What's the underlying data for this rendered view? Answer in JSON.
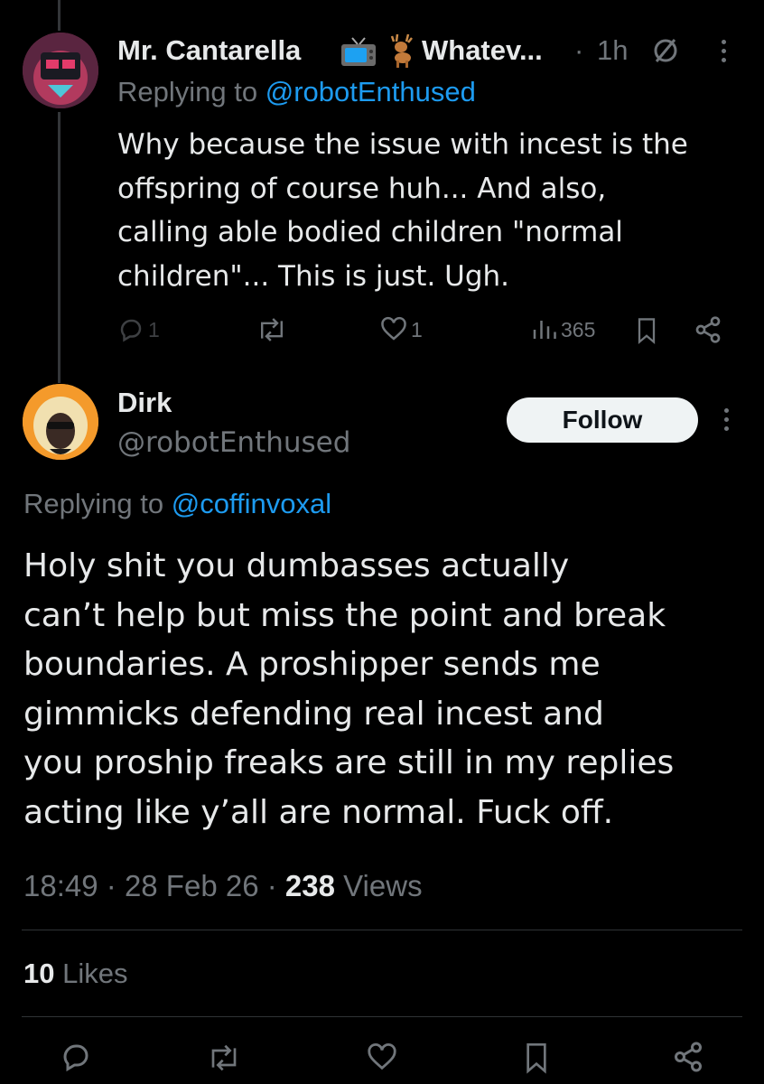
{
  "reply_tweet": {
    "display_name": "Mr. Cantarella",
    "name_suffix": "Whatev...",
    "time_sep": "·",
    "time": "1h",
    "replying_prefix": "Replying to",
    "replying_handle": "@robotEnthused",
    "text_lines": [
      "Why because the issue with incest is the",
      "offspring of course huh... And also,",
      "calling able bodied children \"normal",
      "children\"... This is just. Ugh."
    ],
    "reply_count": "1",
    "like_count": "1",
    "view_count": "365",
    "icons": [
      "tv-emoji-icon",
      "deer-emoji-icon",
      "muted-circle-icon",
      "more-icon"
    ]
  },
  "main_tweet": {
    "display_name": "Dirk",
    "handle": "@robotEnthused",
    "follow_label": "Follow",
    "replying_prefix": "Replying to",
    "replying_handle": "@coffinvoxal",
    "text_lines": [
      "Holy shit you dumbasses actually",
      "can’t help but miss the point and break",
      "boundaries. A proshipper sends me",
      "gimmicks defending real incest and",
      "you proship freaks are still in my replies",
      "acting like y’all are normal. Fuck off."
    ],
    "time": "18:49",
    "sep": "·",
    "date": "28 Feb 26",
    "views_count": "238",
    "views_label": "Views",
    "likes_count": "10",
    "likes_label": "Likes"
  },
  "colors": {
    "background": "#000000",
    "text": "#e7e9ea",
    "muted": "#71767b",
    "link": "#1d9bf0",
    "divider": "#2f3336"
  }
}
